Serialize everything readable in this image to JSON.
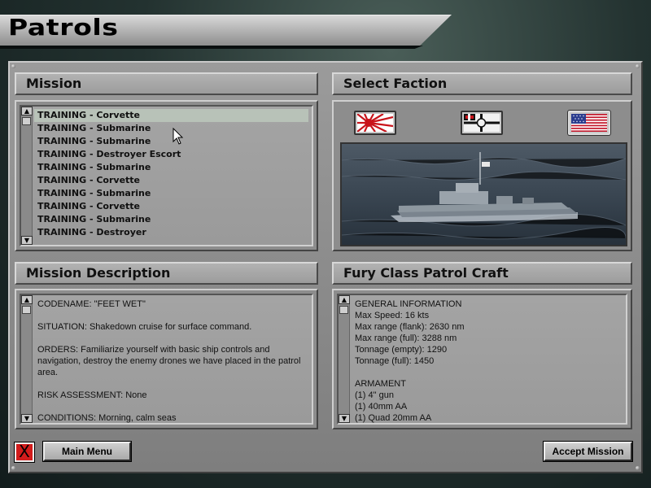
{
  "screen": {
    "title": "Patrols"
  },
  "mission_panel": {
    "header": "Mission",
    "items": [
      "TRAINING - Corvette",
      "TRAINING - Submarine",
      "TRAINING - Submarine",
      "TRAINING - Destroyer Escort",
      "TRAINING - Submarine",
      "TRAINING - Corvette",
      "TRAINING - Submarine",
      "TRAINING - Corvette",
      "TRAINING - Submarine",
      "TRAINING - Destroyer"
    ],
    "selected_index": 0
  },
  "faction_panel": {
    "header": "Select Faction",
    "flags": [
      {
        "name": "japan-flag-icon",
        "active": false
      },
      {
        "name": "germany-flag-icon",
        "active": false
      },
      {
        "name": "usa-flag-icon",
        "active": true
      }
    ]
  },
  "description_panel": {
    "header": "Mission Description",
    "text": "CODENAME: \"FEET WET\"\n\nSITUATION: Shakedown cruise for surface command.\n\nORDERS: Familiarize yourself with basic ship controls and navigation, destroy the enemy drones we have placed in the patrol area.\n\nRISK ASSESSMENT: None\n\nCONDITIONS: Morning, calm seas"
  },
  "ship_panel": {
    "header": "Fury Class Patrol Craft",
    "text": "GENERAL INFORMATION\nMax Speed: 16 kts\nMax range (flank): 2630 nm\nMax range (full): 3288 nm\nTonnage (empty): 1290\nTonnage (full): 1450\n\nARMAMENT\n(1) 4\" gun\n(1) 40mm AA\n(1) Quad 20mm AA"
  },
  "buttons": {
    "close": "X",
    "main_menu": "Main Menu",
    "accept": "Accept Mission"
  },
  "colors": {
    "selection": "#b8c2b8",
    "close_button": "#d21c1c"
  }
}
